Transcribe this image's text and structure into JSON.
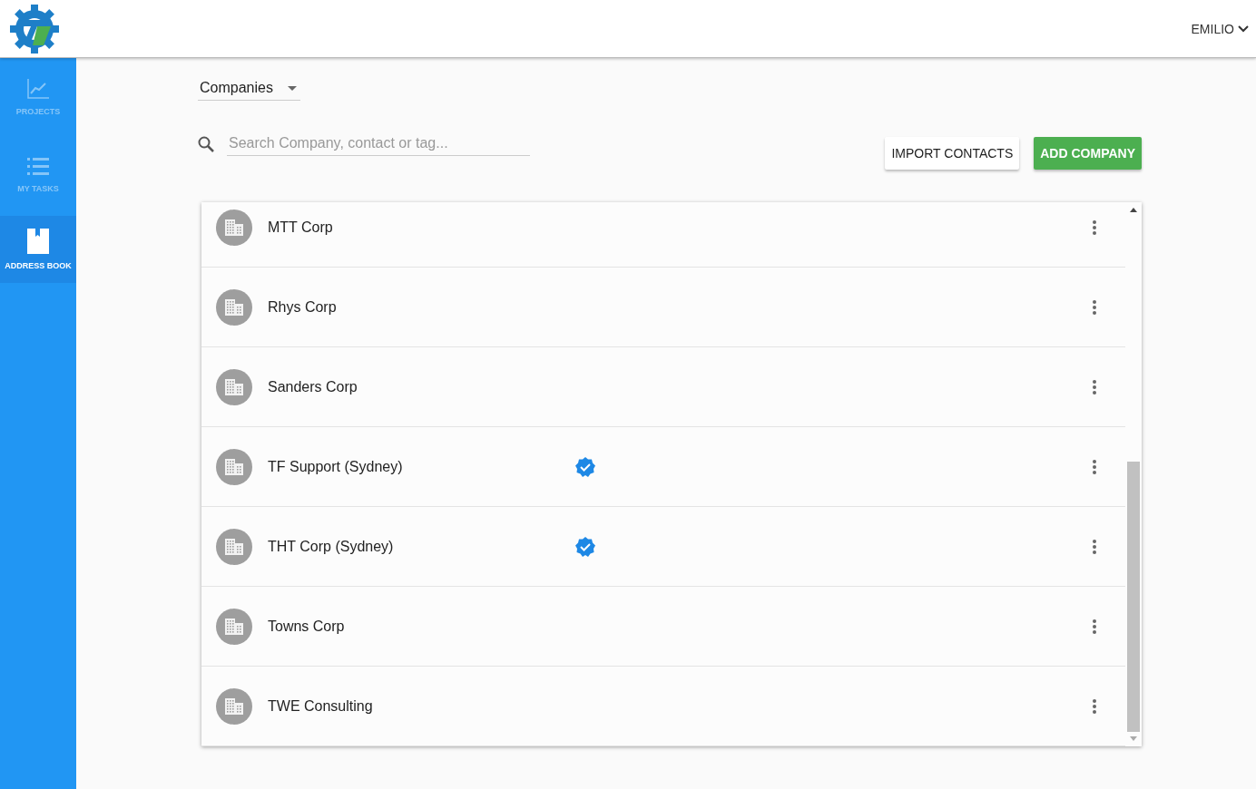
{
  "header": {
    "user_name": "EMILIO"
  },
  "sidebar": {
    "items": [
      {
        "kind": "chart",
        "label": "PROJECTS",
        "selected": false
      },
      {
        "kind": "list",
        "label": "MY TASKS",
        "selected": false
      },
      {
        "kind": "book",
        "label": "ADDRESS BOOK",
        "selected": true
      }
    ]
  },
  "filter": {
    "value": "Companies"
  },
  "search": {
    "placeholder": "Search Company, contact or tag..."
  },
  "buttons": [
    {
      "kind": "plain",
      "label": "IMPORT CONTACTS"
    },
    {
      "kind": "primary",
      "label": "ADD COMPANY"
    }
  ],
  "companies": [
    {
      "name": "MTT Corp",
      "verified": false
    },
    {
      "name": "Rhys Corp",
      "verified": false
    },
    {
      "name": "Sanders Corp",
      "verified": false
    },
    {
      "name": "TF Support (Sydney)",
      "verified": true
    },
    {
      "name": "THT Corp (Sydney)",
      "verified": true
    },
    {
      "name": "Towns Corp",
      "verified": false
    },
    {
      "name": "TWE Consulting",
      "verified": false
    }
  ]
}
